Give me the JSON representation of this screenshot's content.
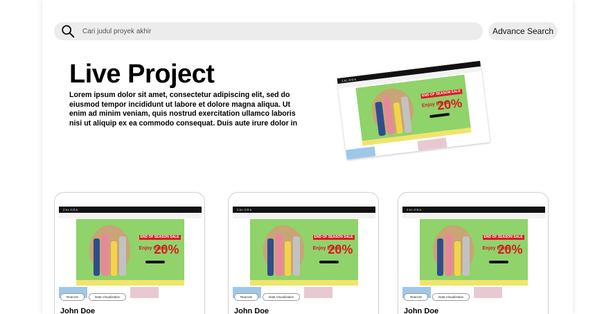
{
  "search": {
    "placeholder": "Cari judul proyek akhir"
  },
  "advance_search_label": "Advance Search",
  "hero": {
    "title": "Live Project",
    "description": "Lorem ipsum dolor sit amet, consectetur adipiscing elit, sed do eiusmod tempor incididunt ut labore et dolore magna aliqua. Ut enim ad minim veniam, quis nostrud exercitation ullamco laboris nisi ut aliquip ex ea commodo consequat. Duis aute irure dolor in"
  },
  "preview": {
    "brand": "ZALORA",
    "promo_badge": "END OF SEASON SALE",
    "promo_text": "Enjoy Extra",
    "promo_percent": "20%"
  },
  "cards": [
    {
      "tags": [
        "ReactJS",
        "Data Visualization"
      ],
      "author": "John Doe"
    },
    {
      "tags": [
        "ReactJS",
        "Data Visualization"
      ],
      "author": "John Doe"
    },
    {
      "tags": [
        "ReactJS",
        "Data Visualization"
      ],
      "author": "John Doe"
    }
  ],
  "colors": {
    "banner_green": "#8fd36a",
    "promo_red": "#d71c24",
    "search_bg": "#ececec"
  }
}
